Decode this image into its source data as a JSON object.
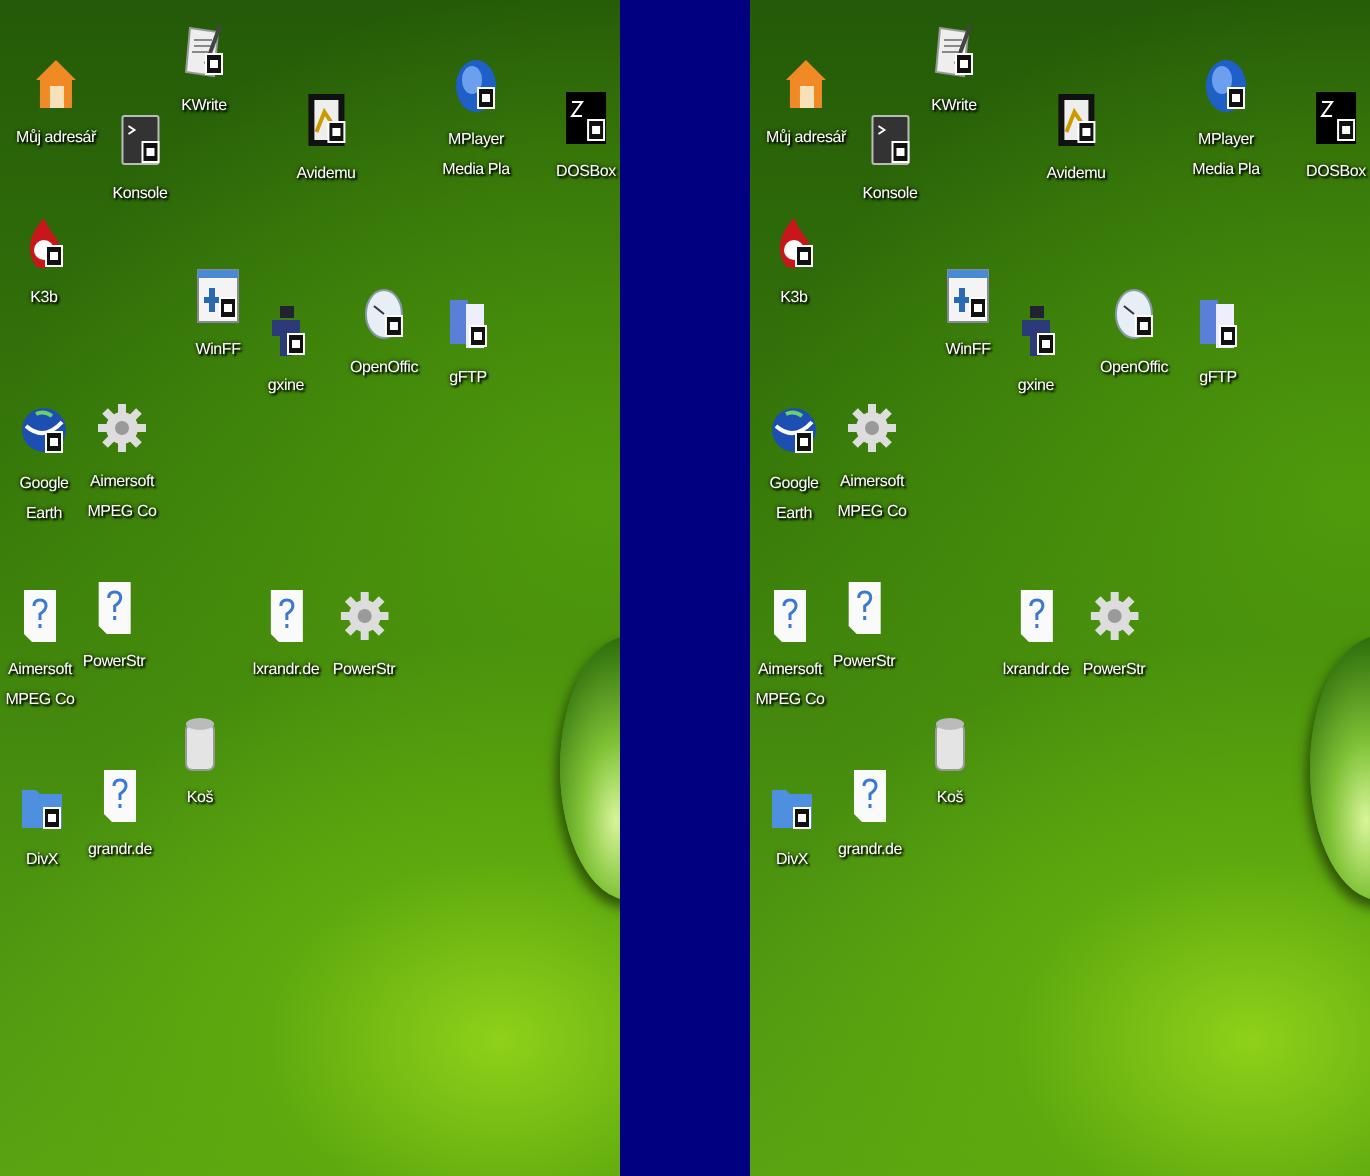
{
  "screens": [
    {
      "icons": [
        {
          "kind": "home",
          "label": "Můj adresář"
        },
        {
          "kind": "terminal",
          "label": "Konsole"
        },
        {
          "kind": "document",
          "label": "KWrite"
        },
        {
          "kind": "film",
          "label": "Avidemu"
        },
        {
          "kind": "disc",
          "label": "MPlayer Media Pla"
        },
        {
          "kind": "dos",
          "label": "DOSBox"
        },
        {
          "kind": "flame",
          "label": "K3b"
        },
        {
          "kind": "window",
          "label": "WinFF"
        },
        {
          "kind": "figure",
          "label": "gxine"
        },
        {
          "kind": "clock",
          "label": "OpenOffic"
        },
        {
          "kind": "server",
          "label": "gFTP"
        },
        {
          "kind": "globe",
          "label": "Google Earth"
        },
        {
          "kind": "gear",
          "label": "Aimersoft MPEG Co"
        },
        {
          "kind": "unknown",
          "label": "Aimersoft MPEG Co"
        },
        {
          "kind": "unknown",
          "label": "PowerStr"
        },
        {
          "kind": "unknown",
          "label": "lxrandr.de"
        },
        {
          "kind": "gear",
          "label": "PowerStr"
        },
        {
          "kind": "trash",
          "label": "Koš"
        },
        {
          "kind": "folder",
          "label": "DivX"
        },
        {
          "kind": "unknown",
          "label": "grandr.de"
        }
      ]
    },
    {
      "icons": [
        {
          "kind": "home",
          "label": "Můj adresář"
        },
        {
          "kind": "terminal",
          "label": "Konsole"
        },
        {
          "kind": "document",
          "label": "KWrite"
        },
        {
          "kind": "film",
          "label": "Avidemu"
        },
        {
          "kind": "disc",
          "label": "MPlayer Media Pla"
        },
        {
          "kind": "dos",
          "label": "DOSBox"
        },
        {
          "kind": "flame",
          "label": "K3b"
        },
        {
          "kind": "window",
          "label": "WinFF"
        },
        {
          "kind": "figure",
          "label": "gxine"
        },
        {
          "kind": "clock",
          "label": "OpenOffic"
        },
        {
          "kind": "server",
          "label": "gFTP"
        },
        {
          "kind": "globe",
          "label": "Google Earth"
        },
        {
          "kind": "gear",
          "label": "Aimersoft MPEG Co"
        },
        {
          "kind": "unknown",
          "label": "Aimersoft MPEG Co"
        },
        {
          "kind": "unknown",
          "label": "PowerStr"
        },
        {
          "kind": "unknown",
          "label": "lxrandr.de"
        },
        {
          "kind": "gear",
          "label": "PowerStr"
        },
        {
          "kind": "trash",
          "label": "Koš"
        },
        {
          "kind": "folder",
          "label": "DivX"
        },
        {
          "kind": "unknown",
          "label": "grandr.de"
        }
      ]
    }
  ]
}
